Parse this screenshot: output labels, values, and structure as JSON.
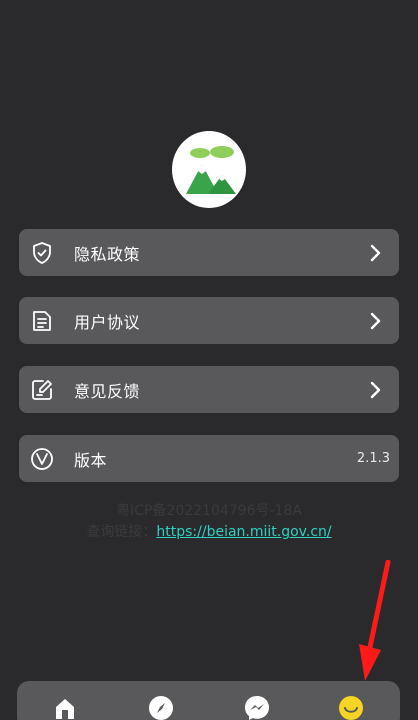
{
  "menu": {
    "items": [
      {
        "label": "隐私政策",
        "icon": "shield-check-icon"
      },
      {
        "label": "用户协议",
        "icon": "document-icon"
      },
      {
        "label": "意见反馈",
        "icon": "feedback-edit-icon"
      },
      {
        "label": "版本",
        "icon": "version-v-icon",
        "value": "2.1.3"
      }
    ]
  },
  "footer": {
    "icp": "粤ICP备2022104796号-18A",
    "query_prefix": "查询链接：",
    "query_link": "https://beian.miit.gov.cn/"
  },
  "bottom_nav": {
    "items": [
      {
        "icon": "home-icon"
      },
      {
        "icon": "compass-icon"
      },
      {
        "icon": "chat-bubble-icon"
      },
      {
        "icon": "smiley-icon",
        "active": true
      }
    ]
  },
  "colors": {
    "background": "#2a2a2c",
    "card": "#59595c",
    "link": "#31d0c3",
    "active_tab": "#f5d423",
    "annotation_arrow": "#ff1a1a"
  }
}
